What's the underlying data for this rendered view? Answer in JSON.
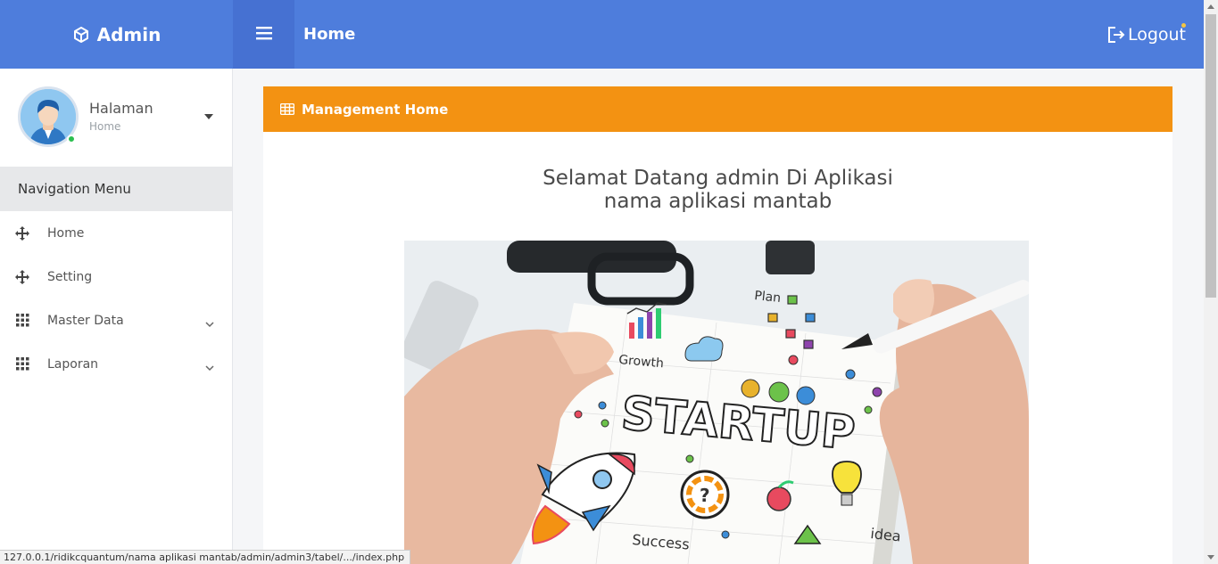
{
  "header": {
    "brand": "Admin",
    "brand_icon": "cube-icon",
    "menu_icon": "hamburger-icon",
    "title": "Home",
    "logout_label": "Logout",
    "logout_icon": "sign-out-icon",
    "bg_color": "#4e7ddc"
  },
  "sidebar": {
    "profile": {
      "name": "Halaman",
      "subtitle": "Home",
      "status": "online"
    },
    "nav_heading": "Navigation Menu",
    "items": [
      {
        "label": "Home",
        "icon": "move-arrows-icon",
        "has_submenu": false
      },
      {
        "label": "Setting",
        "icon": "move-arrows-icon",
        "has_submenu": false
      },
      {
        "label": "Master Data",
        "icon": "grid-dots-icon",
        "has_submenu": true
      },
      {
        "label": "Laporan",
        "icon": "grid-dots-icon",
        "has_submenu": true
      }
    ]
  },
  "main": {
    "card_title": "Management Home",
    "card_icon": "table-icon",
    "card_color": "#f39212",
    "welcome_line1": "Selamat Datang admin Di Aplikasi",
    "welcome_line2": "nama aplikasi mantab",
    "image": {
      "growth": "Growth",
      "plan": "Plan",
      "startup": "STARTUP",
      "success": "Success",
      "idea": "idea"
    }
  },
  "status_bar": {
    "url": "127.0.0.1/ridikcquantum/nama aplikasi mantab/admin/admin3/tabel/.../index.php"
  }
}
